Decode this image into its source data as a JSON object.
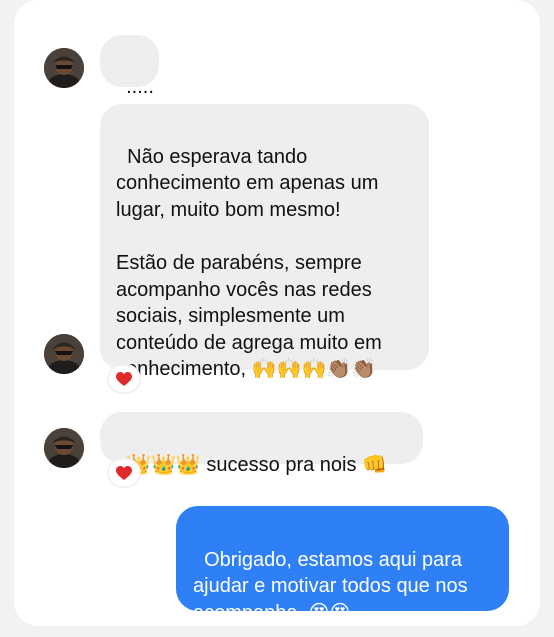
{
  "conversation": {
    "messages": [
      {
        "from": "them",
        "text": "....."
      },
      {
        "from": "them",
        "text": "Não esperava tando\nconhecimento em apenas um\nlugar, muito bom mesmo!\n\nEstão de parabéns, sempre\nacompanho vocês nas redes\nsociais, simplesmente um\nconteúdo de agrega muito em\nconhecimento, 🙌🙌🙌👏🏽👏🏽",
        "reaction": "heart-icon"
      },
      {
        "from": "them",
        "text": "👑👑👑 sucesso pra nois 👊",
        "reaction": "heart-icon"
      },
      {
        "from": "me",
        "text": "Obrigado, estamos aqui para\najudar e motivar todos que nos\nacompanha. 😍😍"
      }
    ]
  },
  "colors": {
    "incoming_bubble": "#eeeeef",
    "outgoing_bubble": "#2f80f7",
    "reaction_heart": "#e02a2a"
  }
}
